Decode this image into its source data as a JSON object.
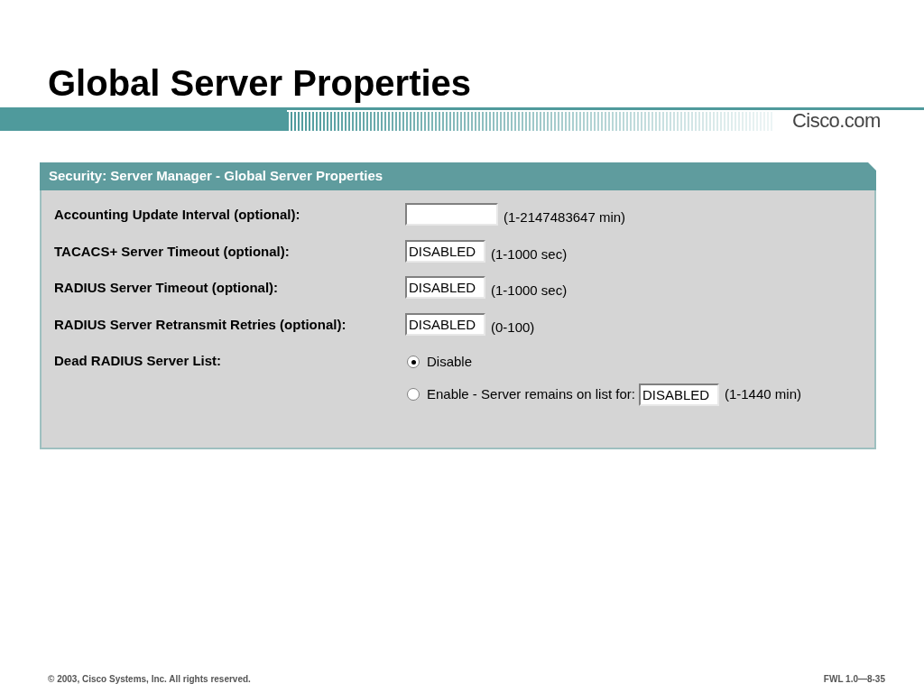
{
  "slide_title": "Global Server Properties",
  "banner": {
    "logo": "Cisco.com"
  },
  "panel": {
    "title": "Security: Server Manager - Global Server Properties",
    "fields": [
      {
        "label": "Accounting Update Interval (optional):",
        "range": "(1-2147483647 min)"
      },
      {
        "label": "TACACS+ Server Timeout (optional):",
        "value": "DISABLED",
        "range": "(1-1000 sec)"
      },
      {
        "label": "RADIUS Server Timeout (optional):",
        "value": "DISABLED",
        "range": "(1-1000 sec)"
      },
      {
        "label": "RADIUS Server Retransmit Retries (optional):",
        "value": "DISABLED",
        "range": "(0-100)"
      }
    ],
    "dead_list": {
      "label": "Dead RADIUS Server List:",
      "options": [
        {
          "label": "Disable",
          "selected": true
        },
        {
          "label": "Enable - Server remains on list for:",
          "selected": false,
          "value": "DISABLED",
          "range": "(1-1440 min)"
        }
      ]
    }
  },
  "footer": {
    "copyright": "© 2003, Cisco Systems, Inc. All rights reserved.",
    "code": "FWL 1.0—8-35"
  }
}
